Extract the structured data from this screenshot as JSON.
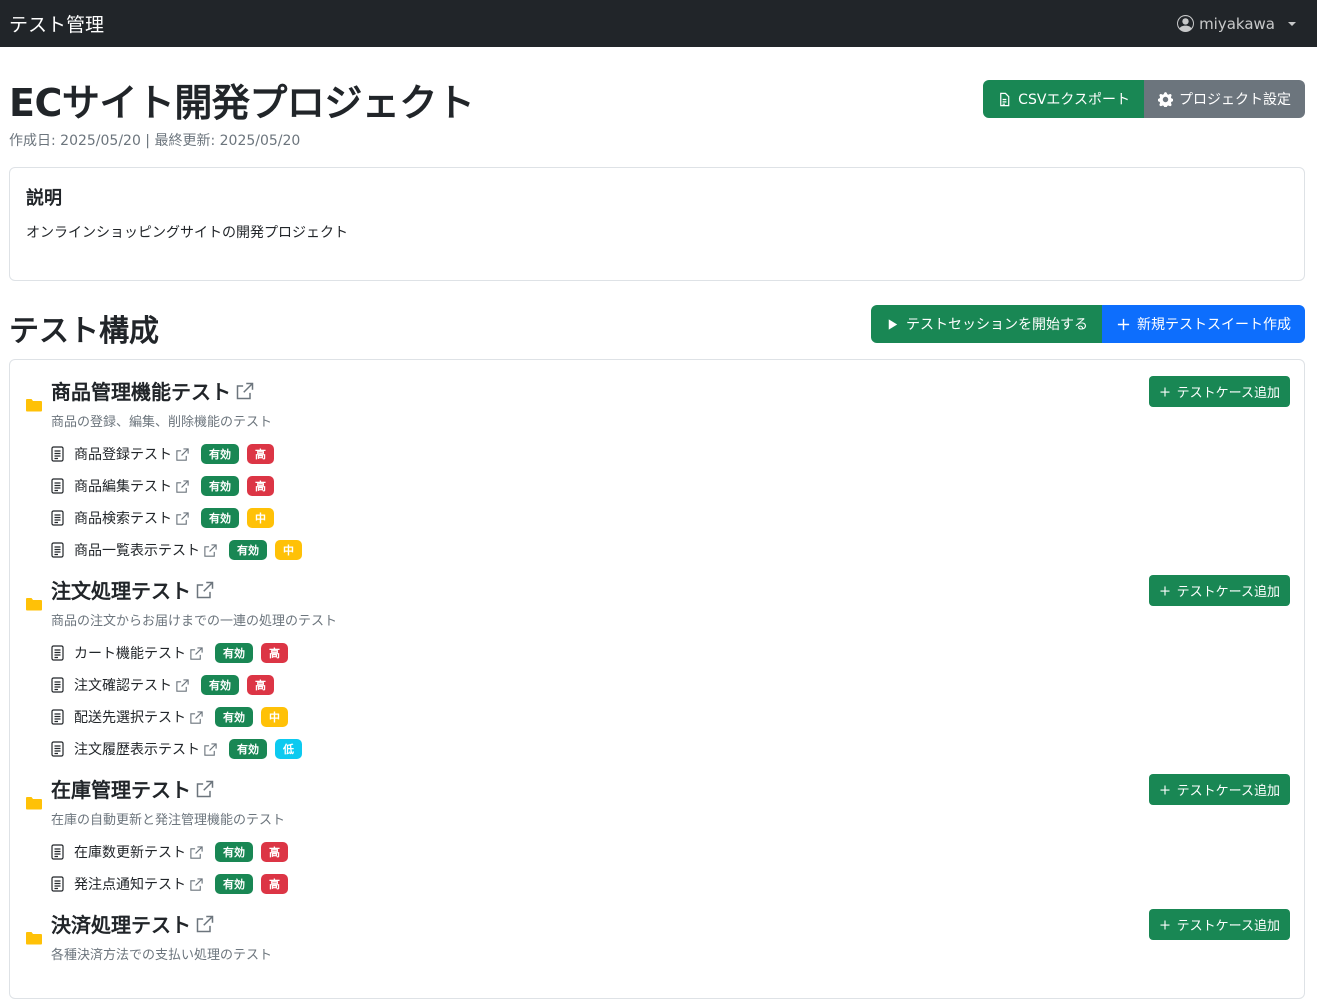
{
  "nav": {
    "brand": "テスト管理",
    "user": "miyakawa"
  },
  "project": {
    "title": "ECサイト開発プロジェクト",
    "meta": "作成日: 2025/05/20 | 最終更新: 2025/05/20",
    "csv_export": "CSVエクスポート",
    "settings": "プロジェクト設定"
  },
  "description": {
    "title": "説明",
    "text": "オンラインショッピングサイトの開発プロジェクト"
  },
  "section": {
    "title": "テスト構成",
    "start_session": "テストセッションを開始する",
    "new_suite": "新規テストスイート作成"
  },
  "add_case_label": "テストケース追加",
  "colors": {
    "success": "#198754",
    "danger": "#dc3545",
    "warning": "#ffc107",
    "info": "#0dcaf0",
    "primary": "#0d6efd",
    "secondary": "#6c757d",
    "folder": "#ffc107"
  },
  "suites": [
    {
      "title": "商品管理機能テスト",
      "desc": "商品の登録、編集、削除機能のテスト",
      "cases": [
        {
          "name": "商品登録テスト",
          "status": "有効",
          "priority": "高",
          "level": "high"
        },
        {
          "name": "商品編集テスト",
          "status": "有効",
          "priority": "高",
          "level": "high"
        },
        {
          "name": "商品検索テスト",
          "status": "有効",
          "priority": "中",
          "level": "mid"
        },
        {
          "name": "商品一覧表示テスト",
          "status": "有効",
          "priority": "中",
          "level": "mid"
        }
      ]
    },
    {
      "title": "注文処理テスト",
      "desc": "商品の注文からお届けまでの一連の処理のテスト",
      "cases": [
        {
          "name": "カート機能テスト",
          "status": "有効",
          "priority": "高",
          "level": "high"
        },
        {
          "name": "注文確認テスト",
          "status": "有効",
          "priority": "高",
          "level": "high"
        },
        {
          "name": "配送先選択テスト",
          "status": "有効",
          "priority": "中",
          "level": "mid"
        },
        {
          "name": "注文履歴表示テスト",
          "status": "有効",
          "priority": "低",
          "level": "low"
        }
      ]
    },
    {
      "title": "在庫管理テスト",
      "desc": "在庫の自動更新と発注管理機能のテスト",
      "cases": [
        {
          "name": "在庫数更新テスト",
          "status": "有効",
          "priority": "高",
          "level": "high"
        },
        {
          "name": "発注点通知テスト",
          "status": "有効",
          "priority": "高",
          "level": "high"
        }
      ]
    },
    {
      "title": "決済処理テスト",
      "desc": "各種決済方法での支払い処理のテスト",
      "cases": []
    }
  ]
}
